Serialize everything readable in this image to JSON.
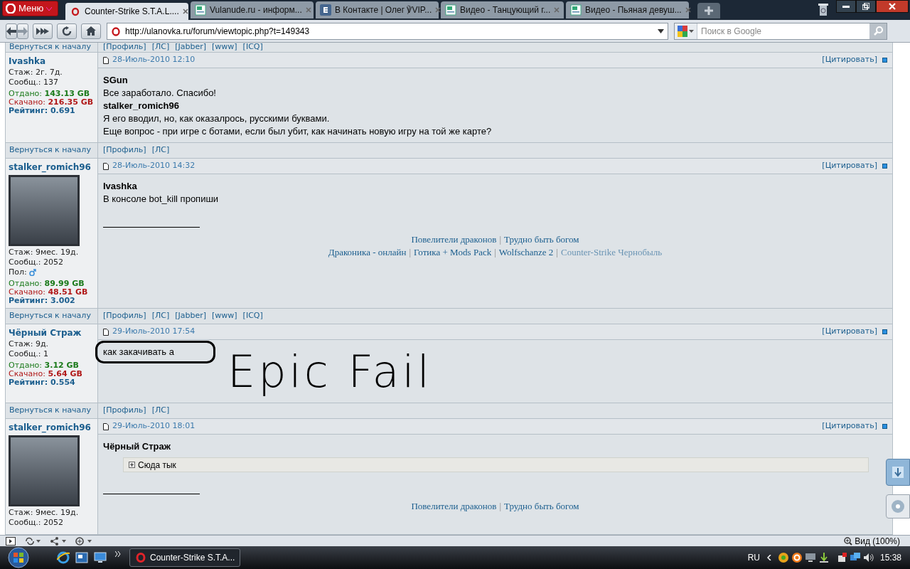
{
  "browser": {
    "menu_button": "Меню",
    "tabs": [
      {
        "title": "Counter-Strike S.T.A.L....",
        "kind": "opera",
        "selected": true
      },
      {
        "title": "Vulanude.ru - информ...",
        "kind": "page",
        "selected": false
      },
      {
        "title": "В Контакте | Олег ℣VIP...",
        "kind": "vk",
        "selected": false
      },
      {
        "title": "Видео - Танцующий г...",
        "kind": "page",
        "selected": false
      },
      {
        "title": "Видео - Пьяная девуш...",
        "kind": "page",
        "selected": false
      }
    ],
    "address": "http://ulanovka.ru/forum/viewtopic.php?t=149343",
    "search_placeholder": "Поиск в Google"
  },
  "top_footer": {
    "back": "Вернуться к началу",
    "links": [
      "[Профиль]",
      "[ЛС]",
      "[Jabber]",
      "[www]",
      "[ICQ]"
    ]
  },
  "posts": [
    {
      "author": "Ivashka",
      "avatar": false,
      "stats": [
        {
          "kind": "plain",
          "text": "Стаж: 2г. 7д."
        },
        {
          "kind": "plain",
          "text": "Сообщ.: 137"
        },
        {
          "kind": "uploaded",
          "text": "Отдано: **143.13 GB**"
        },
        {
          "kind": "downloaded",
          "text": "Скачано: **216.35 GB**"
        },
        {
          "kind": "rating",
          "text": "Рейтинг: 0.691"
        }
      ],
      "date": "28-Июль-2010 12:10",
      "quote_button": "[Цитировать]",
      "body": [
        {
          "kind": "quote_name",
          "text": "SGun"
        },
        {
          "kind": "text",
          "text": "Все заработало. Спасибо!"
        },
        {
          "kind": "quote_name",
          "text": "stalker_romich96"
        },
        {
          "kind": "text",
          "text": "Я его вводил, но, как оказалрось, русскими буквами."
        },
        {
          "kind": "text",
          "text": "Еще вопрос - при игре с ботами, если был убит, как начинать новую игру на той же карте?"
        }
      ],
      "footer": {
        "back": "Вернуться к началу",
        "links": [
          "[Профиль]",
          "[ЛС]"
        ]
      }
    },
    {
      "author": "stalker_romich96",
      "avatar": true,
      "stats": [
        {
          "kind": "plain",
          "text": "Стаж: 9мес. 19д."
        },
        {
          "kind": "plain",
          "text": "Сообщ.: 2052"
        },
        {
          "kind": "gender",
          "text": "Пол:"
        },
        {
          "kind": "uploaded",
          "text": "Отдано: **89.99 GB**"
        },
        {
          "kind": "downloaded",
          "text": "Скачано: **48.51 GB**"
        },
        {
          "kind": "rating",
          "text": "Рейтинг: 3.002"
        }
      ],
      "date": "28-Июль-2010 14:32",
      "quote_button": "[Цитировать]",
      "body": [
        {
          "kind": "quote_name",
          "text": "Ivashka"
        },
        {
          "kind": "text",
          "text": "В консоле bot_kill пропиши"
        }
      ],
      "signature": {
        "separator": "|",
        "lines": [
          [
            {
              "text": "Повелители драконов",
              "visited": false
            },
            {
              "text": "Трудно быть богом",
              "visited": false
            }
          ],
          [
            {
              "text": "Драконика - онлайн",
              "visited": false
            },
            {
              "text": "Готика + Mods Pack",
              "visited": false
            },
            {
              "text": "Wolfschanze 2",
              "visited": false
            },
            {
              "text": "Counter-Strike Чернобыль",
              "visited": true
            }
          ]
        ]
      },
      "footer": {
        "back": "Вернуться к началу",
        "links": [
          "[Профиль]",
          "[ЛС]",
          "[Jabber]",
          "[www]",
          "[ICQ]"
        ]
      }
    },
    {
      "author": "Чёрный Страж",
      "avatar": false,
      "stats": [
        {
          "kind": "plain",
          "text": "Стаж: 9д."
        },
        {
          "kind": "plain",
          "text": "Сообщ.: 1"
        },
        {
          "kind": "uploaded",
          "text": "Отдано: **3.12 GB**"
        },
        {
          "kind": "downloaded",
          "text": "Скачано: **5.64 GB**"
        },
        {
          "kind": "rating",
          "text": "Рейтинг: 0.554"
        }
      ],
      "date": "29-Июль-2010 17:54",
      "quote_button": "[Цитировать]",
      "body": [
        {
          "kind": "circled_text",
          "text": "как закачивать а"
        }
      ],
      "annotation": "Epic Fail",
      "footer": {
        "back": "Вернуться к началу",
        "links": [
          "[Профиль]",
          "[ЛС]"
        ]
      }
    },
    {
      "author": "stalker_romich96",
      "avatar": true,
      "stats": [
        {
          "kind": "plain",
          "text": "Стаж: 9мес. 19д."
        },
        {
          "kind": "plain",
          "text": "Сообщ.: 2052"
        }
      ],
      "date": "29-Июль-2010 18:01",
      "quote_button": "[Цитировать]",
      "body": [
        {
          "kind": "quote_name",
          "text": "Чёрный Страж"
        },
        {
          "kind": "spoiler",
          "text": "Сюда тык"
        }
      ],
      "signature": {
        "separator": "|",
        "lines": [
          [
            {
              "text": "Повелители драконов",
              "visited": false
            },
            {
              "text": "Трудно быть богом",
              "visited": false
            }
          ]
        ]
      }
    }
  ],
  "status_bar": {
    "zoom": "Вид (100%)"
  },
  "taskbar": {
    "task": "Counter-Strike S.T.A...",
    "language": "RU",
    "clock": "15:38"
  }
}
